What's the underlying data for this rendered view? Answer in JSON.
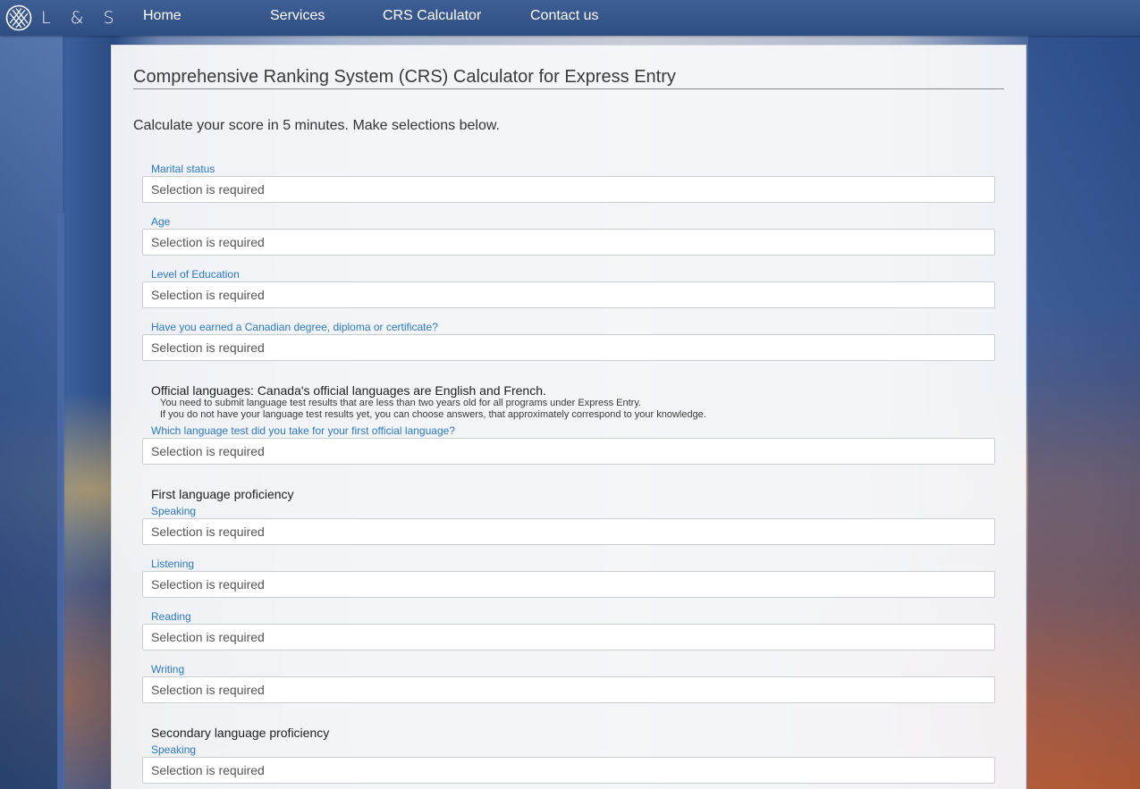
{
  "brand": {
    "logo_text": "L & S",
    "logo_icon": "lattice-logo-icon"
  },
  "nav": {
    "items": [
      "Home",
      "Services",
      "CRS Calculator",
      "Contact us"
    ]
  },
  "page": {
    "title": "Comprehensive Ranking System (CRS) Calculator for Express Entry",
    "intro": "Calculate your score in 5 minutes. Make selections below."
  },
  "fields": {
    "marital_status": {
      "label": "Marital status",
      "value": "Selection is required"
    },
    "age": {
      "label": "Age",
      "value": "Selection is required"
    },
    "education": {
      "label": "Level of Education",
      "value": "Selection is required"
    },
    "canadian_degree": {
      "label": "Have you earned a Canadian degree, diploma or certificate?",
      "value": "Selection is required"
    },
    "language_test": {
      "label": "Which language test did you take for your first official language?",
      "value": "Selection is required"
    },
    "first_speaking": {
      "label": "Speaking",
      "value": "Selection is required"
    },
    "first_listening": {
      "label": "Listening",
      "value": "Selection is required"
    },
    "first_reading": {
      "label": "Reading",
      "value": "Selection is required"
    },
    "first_writing": {
      "label": "Writing",
      "value": "Selection is required"
    },
    "second_speaking": {
      "label": "Speaking",
      "value": "Selection is required"
    }
  },
  "sections": {
    "official_languages": {
      "heading": "Official languages: Canada's official languages are English and French.",
      "note1": "You need to submit language test results that are less than two years old for all programs under Express Entry.",
      "note2": "If you do not have your language test results yet, you can choose answers, that approximately correspond to your knowledge."
    },
    "first_language": {
      "heading": "First language proficiency"
    },
    "secondary_language": {
      "heading": "Secondary language proficiency"
    }
  },
  "colors": {
    "nav_bg": "#33558b",
    "label_blue": "#2b78c2",
    "panel_bg": "#f7f8fa"
  }
}
